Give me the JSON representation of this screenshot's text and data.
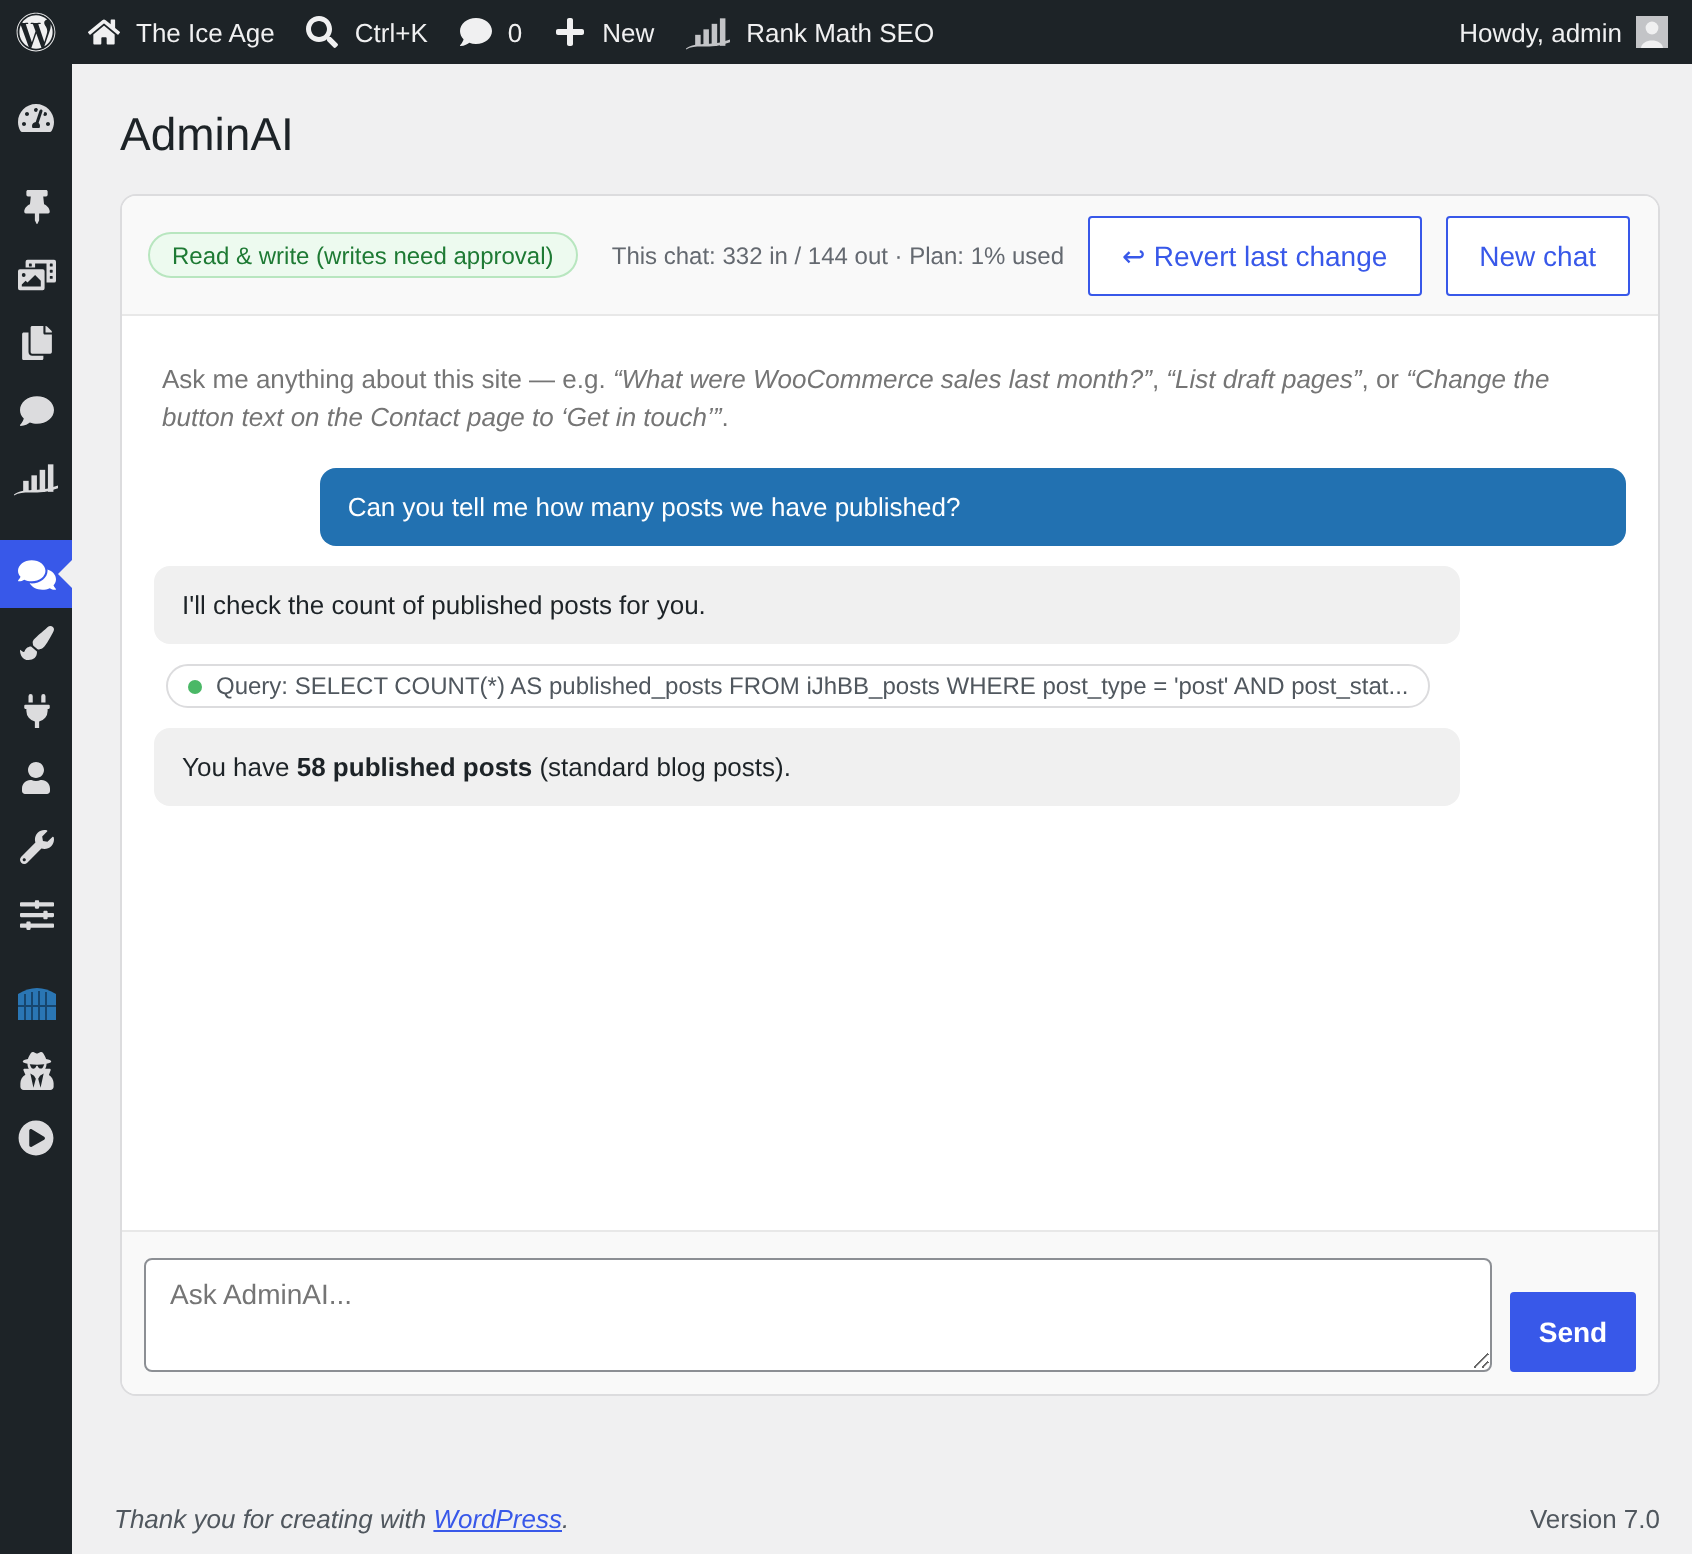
{
  "admin_bar": {
    "items": [
      {
        "label": "The Ice Age"
      },
      {
        "label": "Ctrl+K"
      },
      {
        "label": "0"
      },
      {
        "label": "New"
      },
      {
        "label": "Rank Math SEO"
      }
    ],
    "account": "Howdy, admin"
  },
  "sidebar": {
    "items": [
      {
        "selected": false
      },
      {
        "selected": false
      },
      {
        "selected": false
      },
      {
        "selected": false
      },
      {
        "selected": false
      },
      {
        "selected": false
      },
      {
        "selected": true
      },
      {
        "selected": false
      },
      {
        "selected": false
      },
      {
        "selected": false
      },
      {
        "selected": false
      },
      {
        "selected": false
      },
      {
        "selected": false
      },
      {
        "selected": false
      },
      {
        "selected": false
      }
    ]
  },
  "page_title": "AdminAI",
  "chat": {
    "access": {
      "label": "Read & write (writes need approval)",
      "read_only": false
    },
    "usage": "This chat: 332 in / 144 out · Plan: 1% used",
    "actions": [
      {
        "label": "↩ Revert last change"
      },
      {
        "label": "New chat"
      }
    ],
    "intro": "Ask me anything about this site — e.g. *“What were WooCommerce sales last month?”*, *“List draft pages”*, or *“Change the button text on the Contact page to ‘Get in touch’”*.",
    "messages": [
      {
        "kind": "user",
        "text": "Can you tell me how many posts we have published?"
      },
      {
        "kind": "assistant",
        "text": "I'll check the count of published posts for you."
      },
      {
        "kind": "tool",
        "color": "#4ab866",
        "text": "Query: SELECT COUNT(*) AS published_posts FROM iJhBB_posts WHERE post_type = 'post' AND post_stat..."
      },
      {
        "kind": "assistant",
        "text": "You have **58 published posts** (standard blog posts)."
      }
    ],
    "composer": {
      "placeholder": "Ask AdminAI...",
      "send_label": "Send"
    }
  },
  "footer": {
    "credit_before": "Thank you for creating with ",
    "credit_link": "WordPress",
    "credit_after": ".",
    "version": "Version 7.0"
  }
}
